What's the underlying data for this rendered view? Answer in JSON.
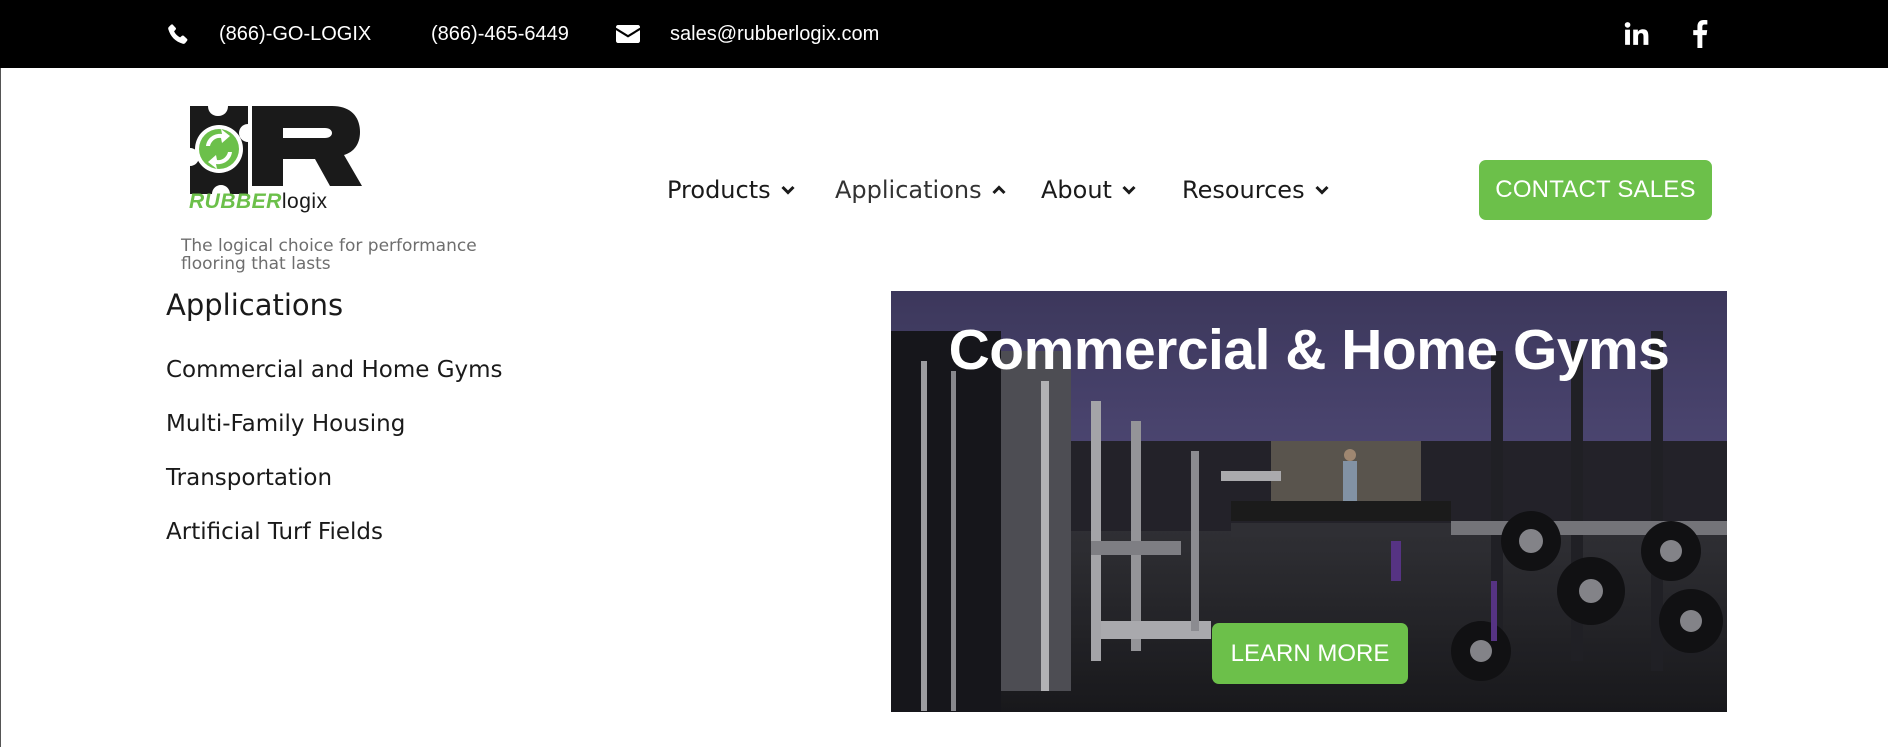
{
  "topbar": {
    "phone_vanity": "(866)-GO-LOGIX",
    "phone_number": "(866)-465-6449",
    "email": "sales@rubberlogix.com",
    "icons": [
      "phone-icon",
      "envelope-icon",
      "linkedin-icon",
      "facebook-icon"
    ]
  },
  "brand": {
    "logo_word_a": "RUBBER",
    "logo_word_b": "logix",
    "tagline": "The logical choice for performance flooring that lasts",
    "colors": {
      "green": "#6cc04a",
      "black": "#1a1a1a"
    }
  },
  "nav": {
    "items": [
      {
        "label": "Products",
        "state": "collapsed"
      },
      {
        "label": "Applications",
        "state": "expanded"
      },
      {
        "label": "About",
        "state": "collapsed"
      },
      {
        "label": "Resources",
        "state": "collapsed"
      }
    ],
    "cta_label": "CONTACT SALES"
  },
  "dropdown": {
    "heading": "Applications",
    "items": [
      "Commercial and Home Gyms",
      "Multi-Family Housing",
      "Transportation",
      "Artificial Turf Fields"
    ]
  },
  "promo": {
    "title": "Commercial & Home Gyms",
    "button_label": "LEARN MORE",
    "image_subject": "gym interior with weight machines and dumbbells"
  },
  "colors": {
    "accent": "#6cc04a",
    "topbar_bg": "#000000"
  }
}
